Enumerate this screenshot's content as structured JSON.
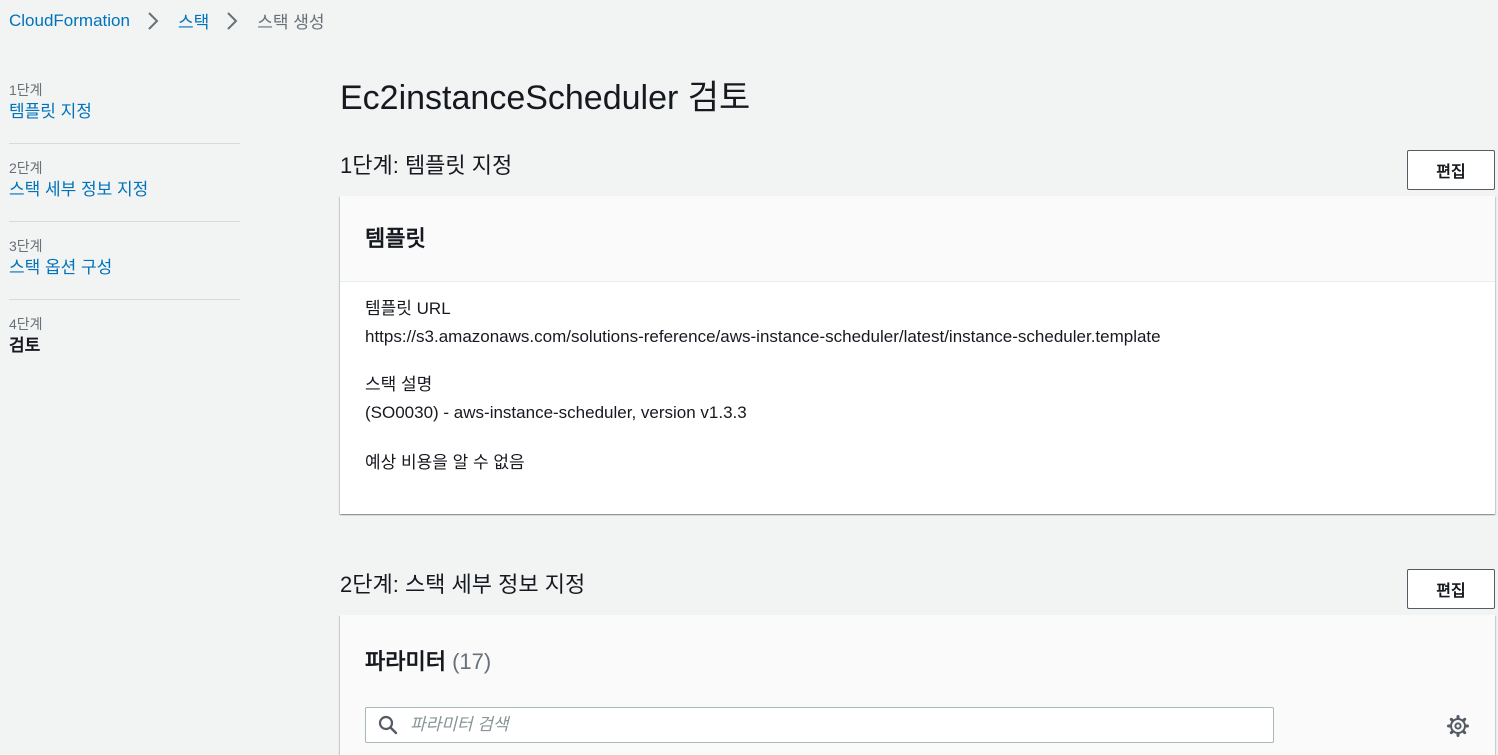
{
  "breadcrumb": {
    "items": [
      "CloudFormation",
      "스택"
    ],
    "current": "스택 생성"
  },
  "steps": [
    {
      "num": "1단계",
      "label": "템플릿 지정"
    },
    {
      "num": "2단계",
      "label": "스택 세부 정보 지정"
    },
    {
      "num": "3단계",
      "label": "스택 옵션 구성"
    },
    {
      "num": "4단계",
      "label": "검토"
    }
  ],
  "page_title": "Ec2instanceScheduler 검토",
  "section1": {
    "title": "1단계: 템플릿 지정",
    "edit_label": "편집",
    "card_title": "템플릿",
    "template_url_label": "템플릿 URL",
    "template_url_value": "https://s3.amazonaws.com/solutions-reference/aws-instance-scheduler/latest/instance-scheduler.template",
    "description_label": "스택 설명",
    "description_value": "(SO0030) - aws-instance-scheduler, version v1.3.3",
    "cost_label": "예상 비용을 알 수 없음"
  },
  "section2": {
    "title": "2단계: 스택 세부 정보 지정",
    "edit_label": "편집",
    "card_title": "파라미터",
    "count": "(17)",
    "search_placeholder": "파라미터 검색"
  },
  "icons": {
    "breadcrumb_separator": "chevron-right-icon",
    "search": "search-icon",
    "settings": "gear-icon"
  },
  "colors": {
    "link": "#0073bb",
    "background": "#f2f3f3",
    "text": "#16191f",
    "muted": "#687078"
  }
}
